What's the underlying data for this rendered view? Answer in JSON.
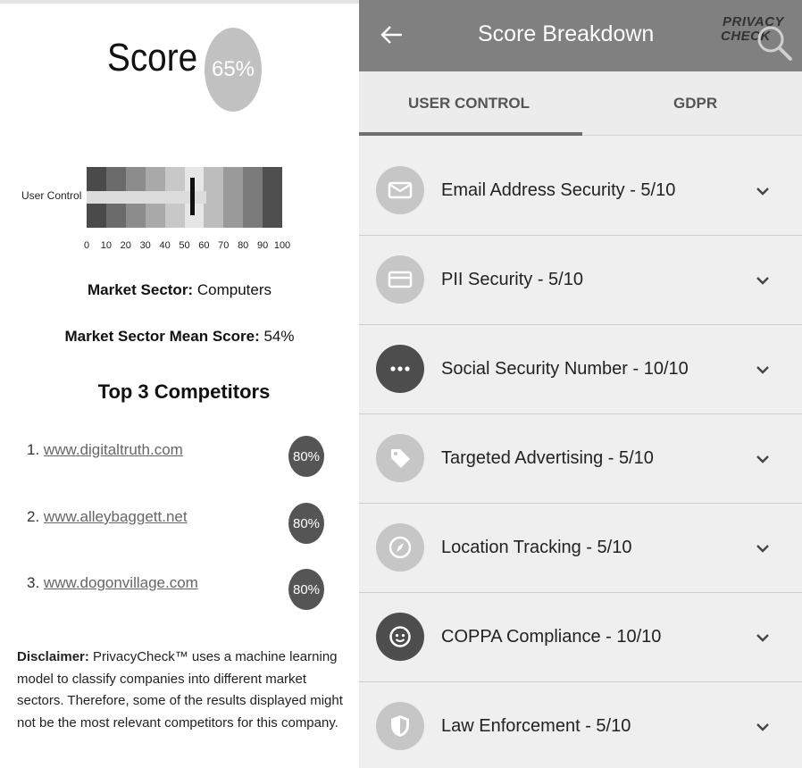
{
  "score": {
    "title": "Score",
    "value": "65%"
  },
  "bullet_chart": {
    "label": "User Control",
    "value": 53,
    "range": [
      0,
      100
    ],
    "band_colors": [
      "#4a4a4a",
      "#6b6b6b",
      "#8c8c8c",
      "#a9a9a9",
      "#c8c8c8",
      "#e6e6e6",
      "#bdbdbd",
      "#9a9a9a",
      "#7a7a7a",
      "#4f4f4f"
    ],
    "ticks": [
      "0",
      "10",
      "20",
      "30",
      "40",
      "50",
      "60",
      "70",
      "80",
      "90",
      "100"
    ]
  },
  "market": {
    "sector_label": "Market Sector:",
    "sector_value": "Computers",
    "mean_label": "Market Sector Mean Score:",
    "mean_value": "54%"
  },
  "competitors": {
    "heading": "Top 3 Competitors",
    "items": [
      {
        "num": "1.",
        "url": "www.digitaltruth.com",
        "score": "80%"
      },
      {
        "num": "2.",
        "url": "www.alleybaggett.net",
        "score": "80%"
      },
      {
        "num": "3.",
        "url": "www.dogonvillage.com",
        "score": "80%"
      }
    ]
  },
  "disclaimer": {
    "label": "Disclaimer:",
    "text": "PrivacyCheck™ uses a machine learning model to classify companies into different market sectors. Therefore, some of the results displayed might not be the most relevant competitors for this company."
  },
  "appbar": {
    "title": "Score Breakdown",
    "logo_line1": "PRIVACY",
    "logo_line2": "CHECK"
  },
  "tabs": [
    {
      "label": "USER CONTROL",
      "active": true
    },
    {
      "label": "GDPR",
      "active": false
    }
  ],
  "breakdown": [
    {
      "label": "Email Address Security - 5/10",
      "icon": "email-icon",
      "color": "#c6c6c6"
    },
    {
      "label": "PII Security - 5/10",
      "icon": "card-icon",
      "color": "#c6c6c6"
    },
    {
      "label": "Social Security Number - 10/10",
      "icon": "more-dots-icon",
      "color": "#4d4d4d"
    },
    {
      "label": "Targeted Advertising - 5/10",
      "icon": "tag-icon",
      "color": "#c6c6c6"
    },
    {
      "label": "Location Tracking - 5/10",
      "icon": "compass-icon",
      "color": "#c6c6c6"
    },
    {
      "label": "COPPA Compliance - 10/10",
      "icon": "child-face-icon",
      "color": "#4d4d4d"
    },
    {
      "label": "Law Enforcement - 5/10",
      "icon": "shield-icon",
      "color": "#c6c6c6"
    }
  ]
}
